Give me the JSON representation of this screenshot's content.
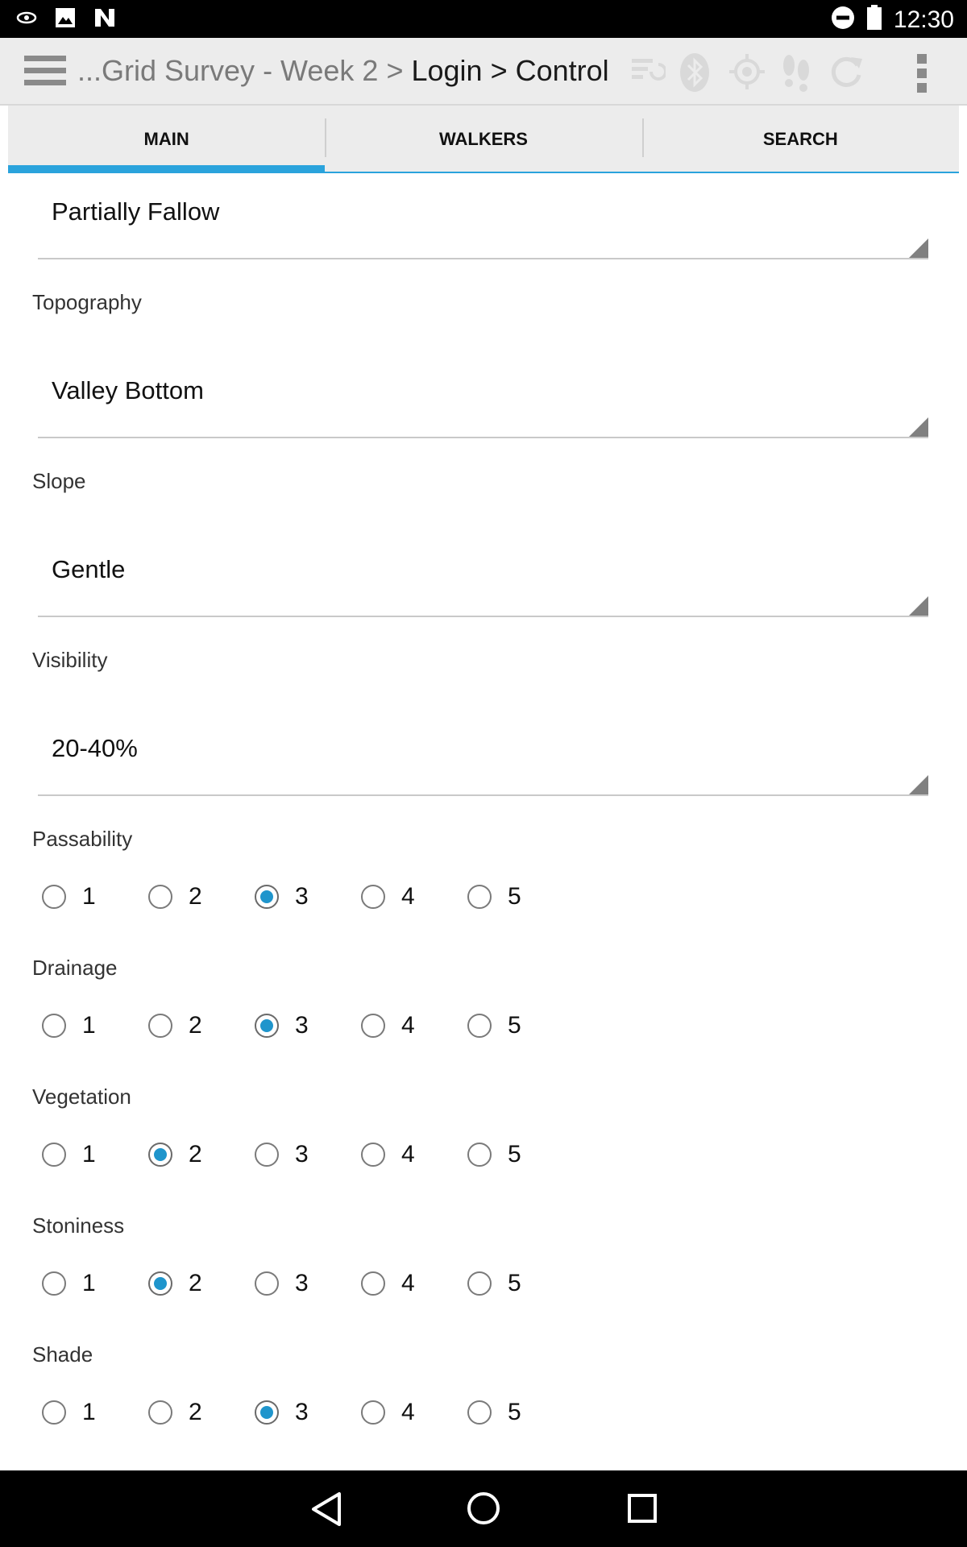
{
  "status_bar": {
    "time": "12:30",
    "icons": [
      "eye-notification-icon",
      "image-notification-icon",
      "n-notification-icon",
      "do-not-disturb-icon",
      "battery-icon"
    ]
  },
  "action_bar": {
    "breadcrumb_prefix": "...Grid Survey - Week 2 > ",
    "breadcrumb_current": "Login > Control",
    "icons": [
      "sync-list-icon",
      "bluetooth-icon",
      "gps-icon",
      "footsteps-icon",
      "refresh-icon",
      "overflow-menu-icon"
    ]
  },
  "tabs": [
    {
      "label": "MAIN",
      "active": true
    },
    {
      "label": "WALKERS",
      "active": false
    },
    {
      "label": "SEARCH",
      "active": false
    }
  ],
  "form": {
    "land_use": {
      "value": "Partially Fallow"
    },
    "topography": {
      "label": "Topography",
      "value": "Valley Bottom"
    },
    "slope": {
      "label": "Slope",
      "value": "Gentle"
    },
    "visibility": {
      "label": "Visibility",
      "value": "20-40%"
    },
    "options": [
      "1",
      "2",
      "3",
      "4",
      "5"
    ],
    "ratings": [
      {
        "label": "Passability",
        "selected": "3"
      },
      {
        "label": "Drainage",
        "selected": "3"
      },
      {
        "label": "Vegetation",
        "selected": "2"
      },
      {
        "label": "Stoniness",
        "selected": "2"
      },
      {
        "label": "Shade",
        "selected": "3"
      }
    ]
  },
  "colors": {
    "accent": "#2aa3dc",
    "radio_fill": "#1f95cc",
    "action_bar_bg": "#ececec"
  }
}
